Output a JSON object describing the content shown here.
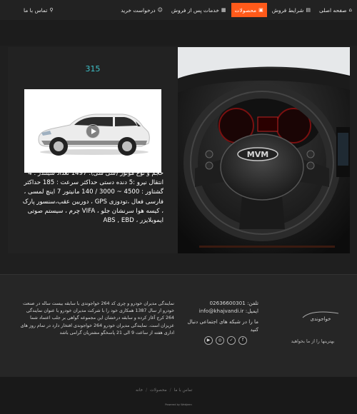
{
  "nav": {
    "items": [
      {
        "label": "صفحه اصلی",
        "icon": "home-icon",
        "glyph": "⌂"
      },
      {
        "label": "شرایط فروش",
        "icon": "document-icon",
        "glyph": "▤"
      },
      {
        "label": "محصولات",
        "icon": "car-icon",
        "glyph": "▣"
      },
      {
        "label": "خدمات پس از فروش",
        "icon": "grid-icon",
        "glyph": "▦"
      },
      {
        "label": "درخواست خرید",
        "icon": "user-icon",
        "glyph": "☺"
      }
    ],
    "contact": {
      "label": "تماس با ما",
      "icon": "location-pin-icon",
      "glyph": "⚲"
    },
    "active_color": "#ff5a1a"
  },
  "product": {
    "count": "315",
    "description": "حجم و نوع موتور (سی سی): 1497 تعداد سیلندر : 4 انتقال نیرو :5 دنده دستی حداکثر سرعت : 185 حداکثر گشتاور : 4500 ~ 3000 / 140 مانیتور 7 اینچ لمسی ، فارسی فعال ،تودوزی GPS ، دوربین عقب،سنسور پارک ، کیسه هوا سرنشان جلو ، VIFA چرم ، سیستم صوتی ایموبلایزر ، ABS , EBD",
    "steering_badge": "MVM",
    "accent": "#3ec1c9"
  },
  "footer": {
    "about": "نمایندگی مدیران خودرو و چری کد 264 خواجوندی با سابقه بیست ساله در صنعت خودرو از سال 1387 همکاری خود را با شرکت مدیران خودرو با عنوان نمایندگی 264 کرج آغاز کرده و سابقه درخشان این مجموعه گواهی بر جلب اعتماد شما عزیزان است. نمایندگی مدیران خودرو 264 خواجوندی افتخار دارد در تمام روز های اداری هفته از ساعت 9 الی 21 پاسخگو مشتریان گرامی باشد",
    "phone": "تلفن: 02636600301",
    "email": "ایمیل: info@khajvandi.ir",
    "social_label": "ما را در شبکه های اجتماعی دنبال کنید",
    "socials": [
      {
        "name": "youtube-icon",
        "glyph": "▶"
      },
      {
        "name": "instagram-icon",
        "glyph": "◎"
      },
      {
        "name": "twitter-icon",
        "glyph": "✓"
      },
      {
        "name": "facebook-icon",
        "glyph": "f"
      }
    ],
    "logo_text": "خواجوندی",
    "tagline": "بهترینها را از ما بخواهید"
  },
  "bottom": {
    "crumbs": [
      "تماس با ما",
      "محصولات",
      "خانه"
    ],
    "powered": "Powered by WebJeen"
  }
}
